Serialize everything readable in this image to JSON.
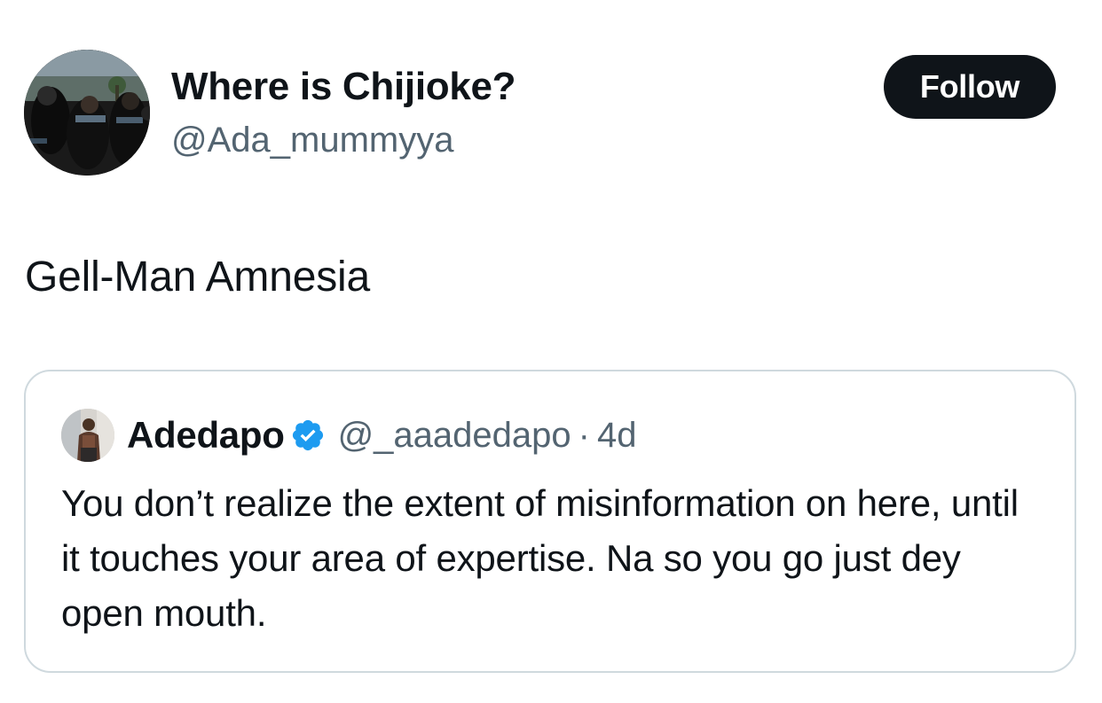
{
  "author": {
    "display_name": "Where is Chijioke?",
    "handle": "@Ada_mummyya",
    "avatar_icon": "user-avatar-photo"
  },
  "follow_label": "Follow",
  "tweet_text": "Gell-Man Amnesia",
  "quoted_tweet": {
    "display_name": "Adedapo",
    "verified_icon": "verified-badge-icon",
    "handle": "@_aaadedapo",
    "separator": "·",
    "time": "4d",
    "text": "You don’t realize the extent of misinformation on here, until it touches your area of expertise. Na so you go just dey open mouth."
  },
  "colors": {
    "text_primary": "#0f1419",
    "text_secondary": "#536471",
    "follow_bg": "#0f1419",
    "verified_blue": "#1d9bf0",
    "card_border": "#cfd9de"
  }
}
